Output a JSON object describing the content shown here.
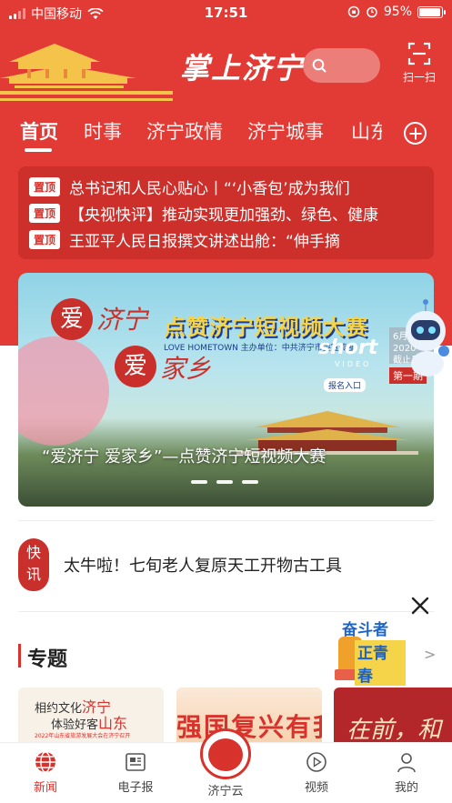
{
  "status_bar": {
    "carrier": "中国移动",
    "time": "17:51",
    "battery": "95%"
  },
  "header": {
    "logo_text": "掌上济宁",
    "scan_label": "扫一扫"
  },
  "tabs": [
    "首页",
    "时事",
    "济宁政情",
    "济宁城事",
    "山东"
  ],
  "active_tab": 0,
  "pinned": {
    "badge": "置顶",
    "items": [
      "总书记和人民心贴心丨“‘小香包’成为我们",
      "【央视快评】推动实现更加强劲、绿色、健康",
      "王亚平人民日报撰文讲述出舱：“伸手摘"
    ]
  },
  "banner": {
    "seal_1": "爱",
    "text_1": "济宁",
    "seal_2": "爱",
    "text_2": "家乡",
    "title": "点赞济宁短视频大赛",
    "subtitle": "LOVE HOMETOWN  主办单位：中共济宁市委宣传部",
    "short_logo": "short",
    "short_sub": "VIDEO",
    "signup": "报名入口",
    "issue_top": "截止日期",
    "issue_date": "6月/1 2020",
    "issue": "第一期",
    "caption": "“爱济宁 爱家乡”—点赞济宁短视频大赛",
    "slide_count": 3
  },
  "flash": {
    "badge_1": "快",
    "badge_2": "讯",
    "text": "太牛啦！七旬老人复原天工开物古工具"
  },
  "topics": {
    "title": "专题",
    "more": ">",
    "promo_line1": "奋斗者",
    "promo_line2": "正青春",
    "cards": [
      {
        "line1_pre": "相约文化",
        "line1_em": "济宁",
        "line2_pre": "体验好客",
        "line2_em": "山东",
        "line3": "2022年山东省旅游发展大会在济宁召开"
      },
      {
        "text": "强国复兴有我"
      },
      {
        "text": "在前，和"
      }
    ]
  },
  "bottom_nav": [
    {
      "label": "新闻",
      "icon": "globe-icon",
      "active": true
    },
    {
      "label": "电子报",
      "icon": "newspaper-icon",
      "active": false
    },
    {
      "label": "济宁云",
      "icon": "cloud-icon",
      "active": false
    },
    {
      "label": "视频",
      "icon": "play-icon",
      "active": false
    },
    {
      "label": "我的",
      "icon": "user-icon",
      "active": false
    }
  ],
  "colors": {
    "brand_red": "#e23a34",
    "accent_red": "#d8322c"
  }
}
